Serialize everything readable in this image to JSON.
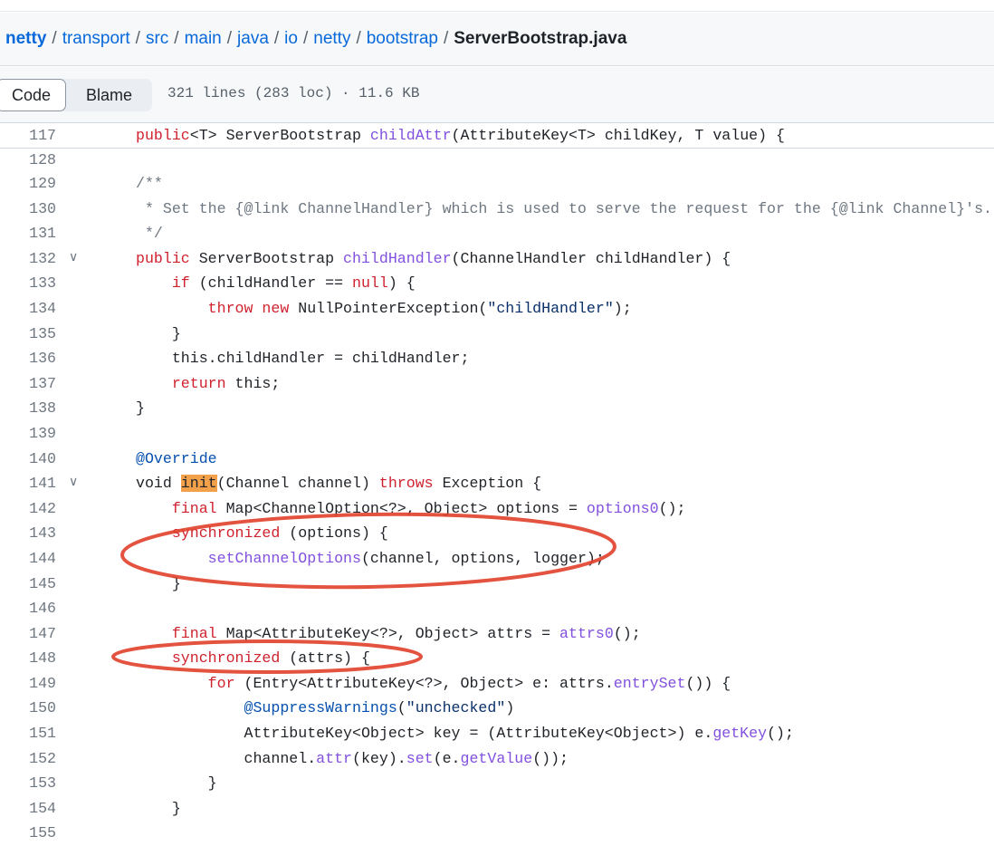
{
  "breadcrumb": {
    "parts": [
      "netty",
      "transport",
      "src",
      "main",
      "java",
      "io",
      "netty",
      "bootstrap"
    ],
    "separator": "/",
    "file": "ServerBootstrap.java"
  },
  "toolbar": {
    "code_label": "Code",
    "blame_label": "Blame",
    "meta": "321 lines (283 loc) · 11.6 KB"
  },
  "colors": {
    "keyword": "#cf222e",
    "function": "#8250df",
    "string": "#0a3069",
    "comment": "#6e7781",
    "annotation_circle": "#e0402a",
    "search_highlight": "#f2a04a"
  },
  "code": {
    "sticky": {
      "n": "117",
      "segs": [
        [
          "k",
          "public"
        ],
        [
          "",
          "<T> ServerBootstrap "
        ],
        [
          "f",
          "childAttr"
        ],
        [
          "",
          "(AttributeKey<T> childKey, T value) {"
        ]
      ]
    },
    "lines": [
      {
        "n": "128",
        "segs": []
      },
      {
        "n": "129",
        "segs": [
          [
            "c",
            "/**"
          ]
        ]
      },
      {
        "n": "130",
        "segs": [
          [
            "c",
            " * Set the {@link ChannelHandler} which is used to serve the request for the {@link Channel}'s."
          ]
        ]
      },
      {
        "n": "131",
        "segs": [
          [
            "c",
            " */"
          ]
        ]
      },
      {
        "n": "132",
        "fold": true,
        "segs": [
          [
            "k",
            "public"
          ],
          [
            "",
            " ServerBootstrap "
          ],
          [
            "f",
            "childHandler"
          ],
          [
            "",
            "(ChannelHandler childHandler) {"
          ]
        ]
      },
      {
        "n": "133",
        "segs": [
          [
            "",
            "    "
          ],
          [
            "k",
            "if"
          ],
          [
            "",
            " (childHandler == "
          ],
          [
            "k",
            "null"
          ],
          [
            "",
            ") {"
          ]
        ]
      },
      {
        "n": "134",
        "segs": [
          [
            "",
            "        "
          ],
          [
            "k",
            "throw new"
          ],
          [
            "",
            " NullPointerException("
          ],
          [
            "s",
            "\"childHandler\""
          ],
          [
            "",
            ");"
          ]
        ]
      },
      {
        "n": "135",
        "segs": [
          [
            "",
            "    }"
          ]
        ]
      },
      {
        "n": "136",
        "segs": [
          [
            "",
            "    this.childHandler = childHandler;"
          ]
        ]
      },
      {
        "n": "137",
        "segs": [
          [
            "",
            "    "
          ],
          [
            "k",
            "return"
          ],
          [
            "",
            " this;"
          ]
        ]
      },
      {
        "n": "138",
        "segs": [
          [
            "",
            "}"
          ]
        ]
      },
      {
        "n": "139",
        "segs": []
      },
      {
        "n": "140",
        "segs": [
          [
            "a",
            "@Override"
          ]
        ]
      },
      {
        "n": "141",
        "fold": true,
        "segs": [
          [
            "",
            "void "
          ],
          [
            "hl",
            "init"
          ],
          [
            "",
            "(Channel channel) "
          ],
          [
            "k",
            "throws"
          ],
          [
            "",
            " Exception {"
          ]
        ]
      },
      {
        "n": "142",
        "segs": [
          [
            "",
            "    "
          ],
          [
            "k",
            "final"
          ],
          [
            "",
            " Map<ChannelOption<?>, Object> options = "
          ],
          [
            "f",
            "options0"
          ],
          [
            "",
            "();"
          ]
        ]
      },
      {
        "n": "143",
        "segs": [
          [
            "",
            "    "
          ],
          [
            "k",
            "synchronized"
          ],
          [
            "",
            " (options) {"
          ]
        ]
      },
      {
        "n": "144",
        "segs": [
          [
            "",
            "        "
          ],
          [
            "f",
            "setChannelOptions"
          ],
          [
            "",
            "(channel, options, logger);"
          ]
        ]
      },
      {
        "n": "145",
        "segs": [
          [
            "",
            "    }"
          ]
        ]
      },
      {
        "n": "146",
        "segs": []
      },
      {
        "n": "147",
        "segs": [
          [
            "",
            "    "
          ],
          [
            "k",
            "final"
          ],
          [
            "",
            " Map<AttributeKey<?>, Object> attrs = "
          ],
          [
            "f",
            "attrs0"
          ],
          [
            "",
            "();"
          ]
        ]
      },
      {
        "n": "148",
        "segs": [
          [
            "",
            "    "
          ],
          [
            "k",
            "synchronized"
          ],
          [
            "",
            " (attrs) {"
          ]
        ]
      },
      {
        "n": "149",
        "segs": [
          [
            "",
            "        "
          ],
          [
            "k",
            "for"
          ],
          [
            "",
            " (Entry<AttributeKey<?>, Object> e: attrs."
          ],
          [
            "f",
            "entrySet"
          ],
          [
            "",
            "()) {"
          ]
        ]
      },
      {
        "n": "150",
        "segs": [
          [
            "",
            "            "
          ],
          [
            "a",
            "@SuppressWarnings"
          ],
          [
            "",
            "("
          ],
          [
            "s",
            "\"unchecked\""
          ],
          [
            "",
            ")"
          ]
        ]
      },
      {
        "n": "151",
        "segs": [
          [
            "",
            "            AttributeKey<Object> key = (AttributeKey<Object>) e."
          ],
          [
            "f",
            "getKey"
          ],
          [
            "",
            "();"
          ]
        ]
      },
      {
        "n": "152",
        "segs": [
          [
            "",
            "            channel."
          ],
          [
            "f",
            "attr"
          ],
          [
            "",
            "(key)."
          ],
          [
            "f",
            "set"
          ],
          [
            "",
            "(e."
          ],
          [
            "f",
            "getValue"
          ],
          [
            "",
            "());"
          ]
        ]
      },
      {
        "n": "153",
        "segs": [
          [
            "",
            "        }"
          ]
        ]
      },
      {
        "n": "154",
        "segs": [
          [
            "",
            "    }"
          ]
        ]
      },
      {
        "n": "155",
        "segs": []
      }
    ]
  }
}
